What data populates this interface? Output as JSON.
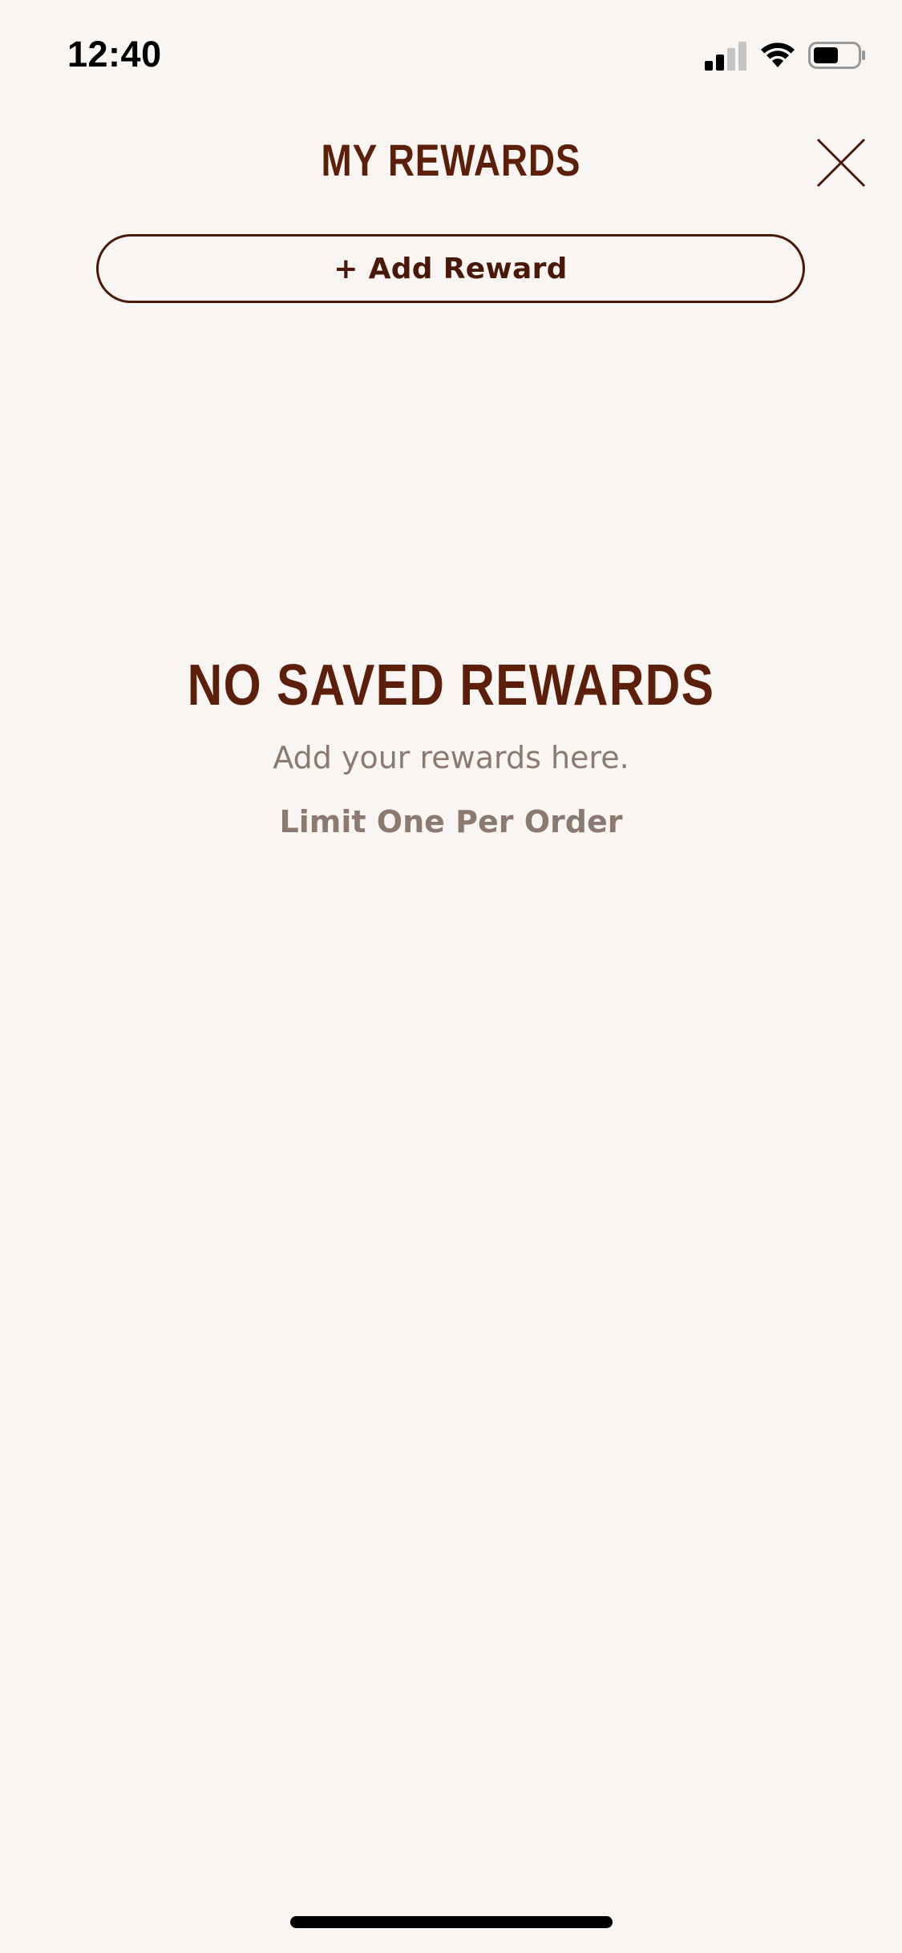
{
  "status_bar": {
    "time": "12:40"
  },
  "header": {
    "title": "MY REWARDS"
  },
  "actions": {
    "add_reward_label": "+ Add Reward"
  },
  "empty_state": {
    "title": "NO SAVED REWARDS",
    "subtitle": "Add your rewards here.",
    "limit_note": "Limit One Per Order"
  },
  "colors": {
    "background": "#f8f5f2",
    "brand_brown": "#5c1f0a",
    "muted_text": "#8c7a70"
  },
  "icons": {
    "signal": "cellular-signal-icon",
    "wifi": "wifi-icon",
    "battery": "battery-icon",
    "close": "close-icon"
  }
}
